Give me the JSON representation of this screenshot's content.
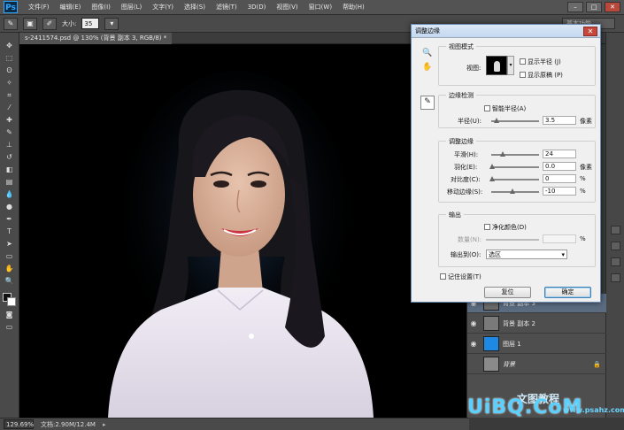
{
  "menubar": {
    "logo": "Ps",
    "items": [
      "文件(F)",
      "编辑(E)",
      "图像(I)",
      "图层(L)",
      "文字(Y)",
      "选择(S)",
      "滤镜(T)",
      "3D(D)",
      "视图(V)",
      "窗口(W)",
      "帮助(H)"
    ],
    "workspace": "基本功能"
  },
  "options": {
    "size_label": "大小:",
    "size_value": "35"
  },
  "document_tab": "s-2411574.psd @ 130% (背景 副本 3, RGB/8) *",
  "status": {
    "zoom": "129.69%",
    "doc": "文档:2.90M/12.4M"
  },
  "dialog": {
    "title": "调整边缘",
    "view_mode": {
      "title": "视图模式",
      "view_label": "视图:",
      "show_radius": "显示半径 (J)",
      "show_original": "显示原稿 (P)"
    },
    "edge_detection": {
      "title": "边缘检测",
      "smart_radius": "智能半径(A)",
      "radius_label": "半径(U):",
      "radius_value": "3.5",
      "radius_unit": "像素",
      "radius_fraction": 0.1
    },
    "adjust_edge": {
      "title": "调整边缘",
      "rows": [
        {
          "label": "平滑(H):",
          "value": "24",
          "unit": "",
          "fraction": 0.24
        },
        {
          "label": "羽化(E):",
          "value": "0.0",
          "unit": "像素",
          "fraction": 0
        },
        {
          "label": "对比度(C):",
          "value": "0",
          "unit": "%",
          "fraction": 0
        },
        {
          "label": "移动边缘(S):",
          "value": "-10",
          "unit": "%",
          "fraction": 0.45
        }
      ]
    },
    "output": {
      "title": "输出",
      "decontaminate": "净化颜色(D)",
      "amount_label": "数量(N):",
      "amount_unit": "%",
      "output_to_label": "输出到(O):",
      "output_to_value": "选区"
    },
    "remember": "记住设置(T)",
    "cancel": "复位",
    "ok": "确定"
  },
  "layers": [
    {
      "name": "背景 副本 3",
      "thumb": "#6b6b6b",
      "active": true
    },
    {
      "name": "背景 副本 2",
      "thumb": "#7a7a7a",
      "active": false
    },
    {
      "name": "图层 1",
      "thumb": "#1e88e5",
      "active": false
    },
    {
      "name": "背景",
      "thumb": "#8a8a8a",
      "active": false
    }
  ],
  "watermark": {
    "brand": "UiBQ.CoM",
    "chinese": "文图教程",
    "url": "www.psahz.com"
  },
  "colors": {
    "accent": "#31a8ff",
    "dialog_bg": "#f0f0f0",
    "layer_blue": "#1e88e5"
  }
}
